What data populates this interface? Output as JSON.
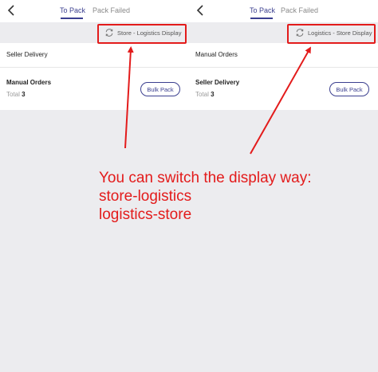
{
  "panels": [
    {
      "tabs": [
        {
          "label": "To Pack",
          "active": true
        },
        {
          "label": "Pack Failed",
          "active": false
        }
      ],
      "switch_label": "Store - Logistics Display",
      "first_row": "Seller Delivery",
      "second_row": {
        "title": "Manual Orders",
        "total_label": "Total",
        "total_value": "3",
        "button": "Bulk Pack"
      }
    },
    {
      "tabs": [
        {
          "label": "To Pack",
          "active": true
        },
        {
          "label": "Pack Failed",
          "active": false
        }
      ],
      "switch_label": "Logistics - Store Display",
      "first_row": "Manual Orders",
      "second_row": {
        "title": "Seller Delivery",
        "total_label": "Total",
        "total_value": "3",
        "button": "Bulk Pack"
      }
    }
  ],
  "annotation": {
    "lines": [
      "You can switch the display way:",
      "store-logistics",
      "logistics-store"
    ],
    "color": "#e31b1b"
  },
  "colors": {
    "accent": "#3b3f8f",
    "gray_bg": "#ececef"
  },
  "icons": {
    "back": "chevron-left-icon",
    "switch": "swap-icon"
  }
}
